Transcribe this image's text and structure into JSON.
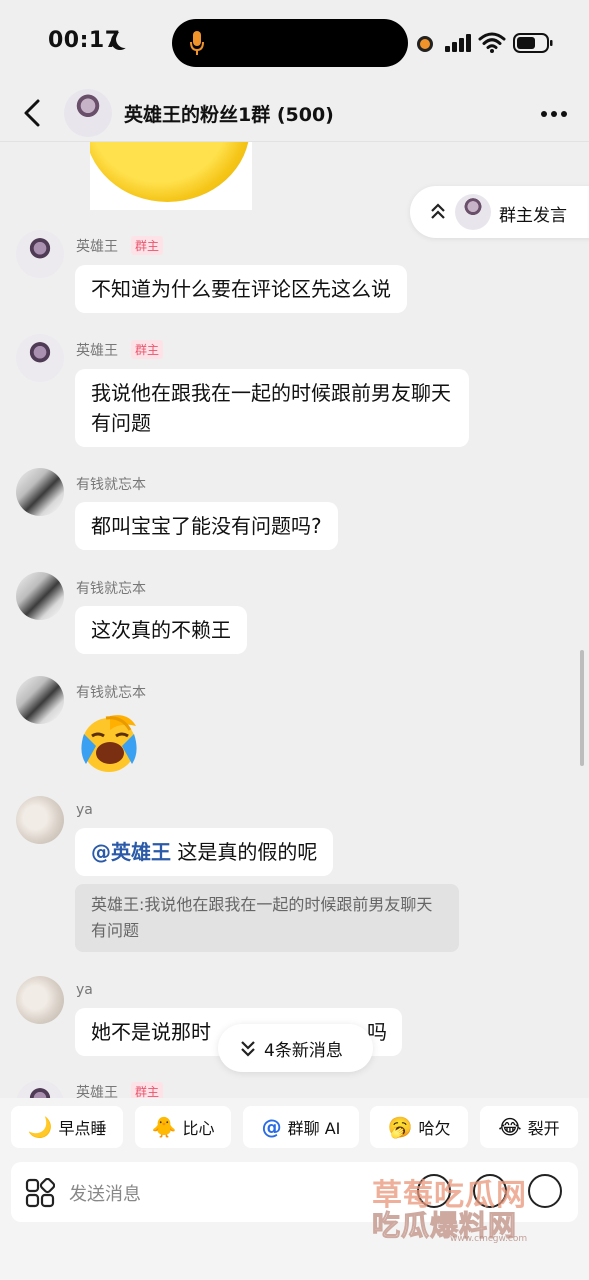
{
  "status_bar": {
    "time": "00:17"
  },
  "header": {
    "title": "英雄王的粉丝1群 (500)"
  },
  "owner_pill": {
    "label": "群主发言"
  },
  "messages": [
    {
      "sender": "英雄王",
      "badge": "群主",
      "text": "不知道为什么要在评论区先这么说"
    },
    {
      "sender": "英雄王",
      "badge": "群主",
      "text": "我说他在跟我在一起的时候跟前男友聊天有问题"
    },
    {
      "sender": "有钱就忘本",
      "text": "都叫宝宝了能没有问题吗?"
    },
    {
      "sender": "有钱就忘本",
      "text": "这次真的不赖王"
    },
    {
      "sender": "有钱就忘本",
      "emoji": "😭"
    },
    {
      "sender": "ya",
      "mention": "@英雄王",
      "text": " 这是真的假的呢",
      "quote": "英雄王:我说他在跟我在一起的时候跟前男友聊天有问题"
    },
    {
      "sender": "ya",
      "text": "她不是说那时",
      "text_tail": "吗"
    },
    {
      "sender": "英雄王",
      "badge": "群主"
    }
  ],
  "new_messages": {
    "label": "4条新消息"
  },
  "quick_replies": [
    {
      "icon": "🌙",
      "label": "早点睡"
    },
    {
      "icon": "🐥",
      "label": "比心"
    },
    {
      "icon": "@",
      "label": "群聊 AI"
    },
    {
      "icon": "🥱",
      "label": "哈欠"
    },
    {
      "icon": "😂",
      "label": "裂开"
    }
  ],
  "input": {
    "placeholder": "发送消息"
  },
  "watermark": {
    "line1": "草莓吃瓜网",
    "line2": "吃瓜爆料网",
    "url": "www.cmcgw.com"
  }
}
